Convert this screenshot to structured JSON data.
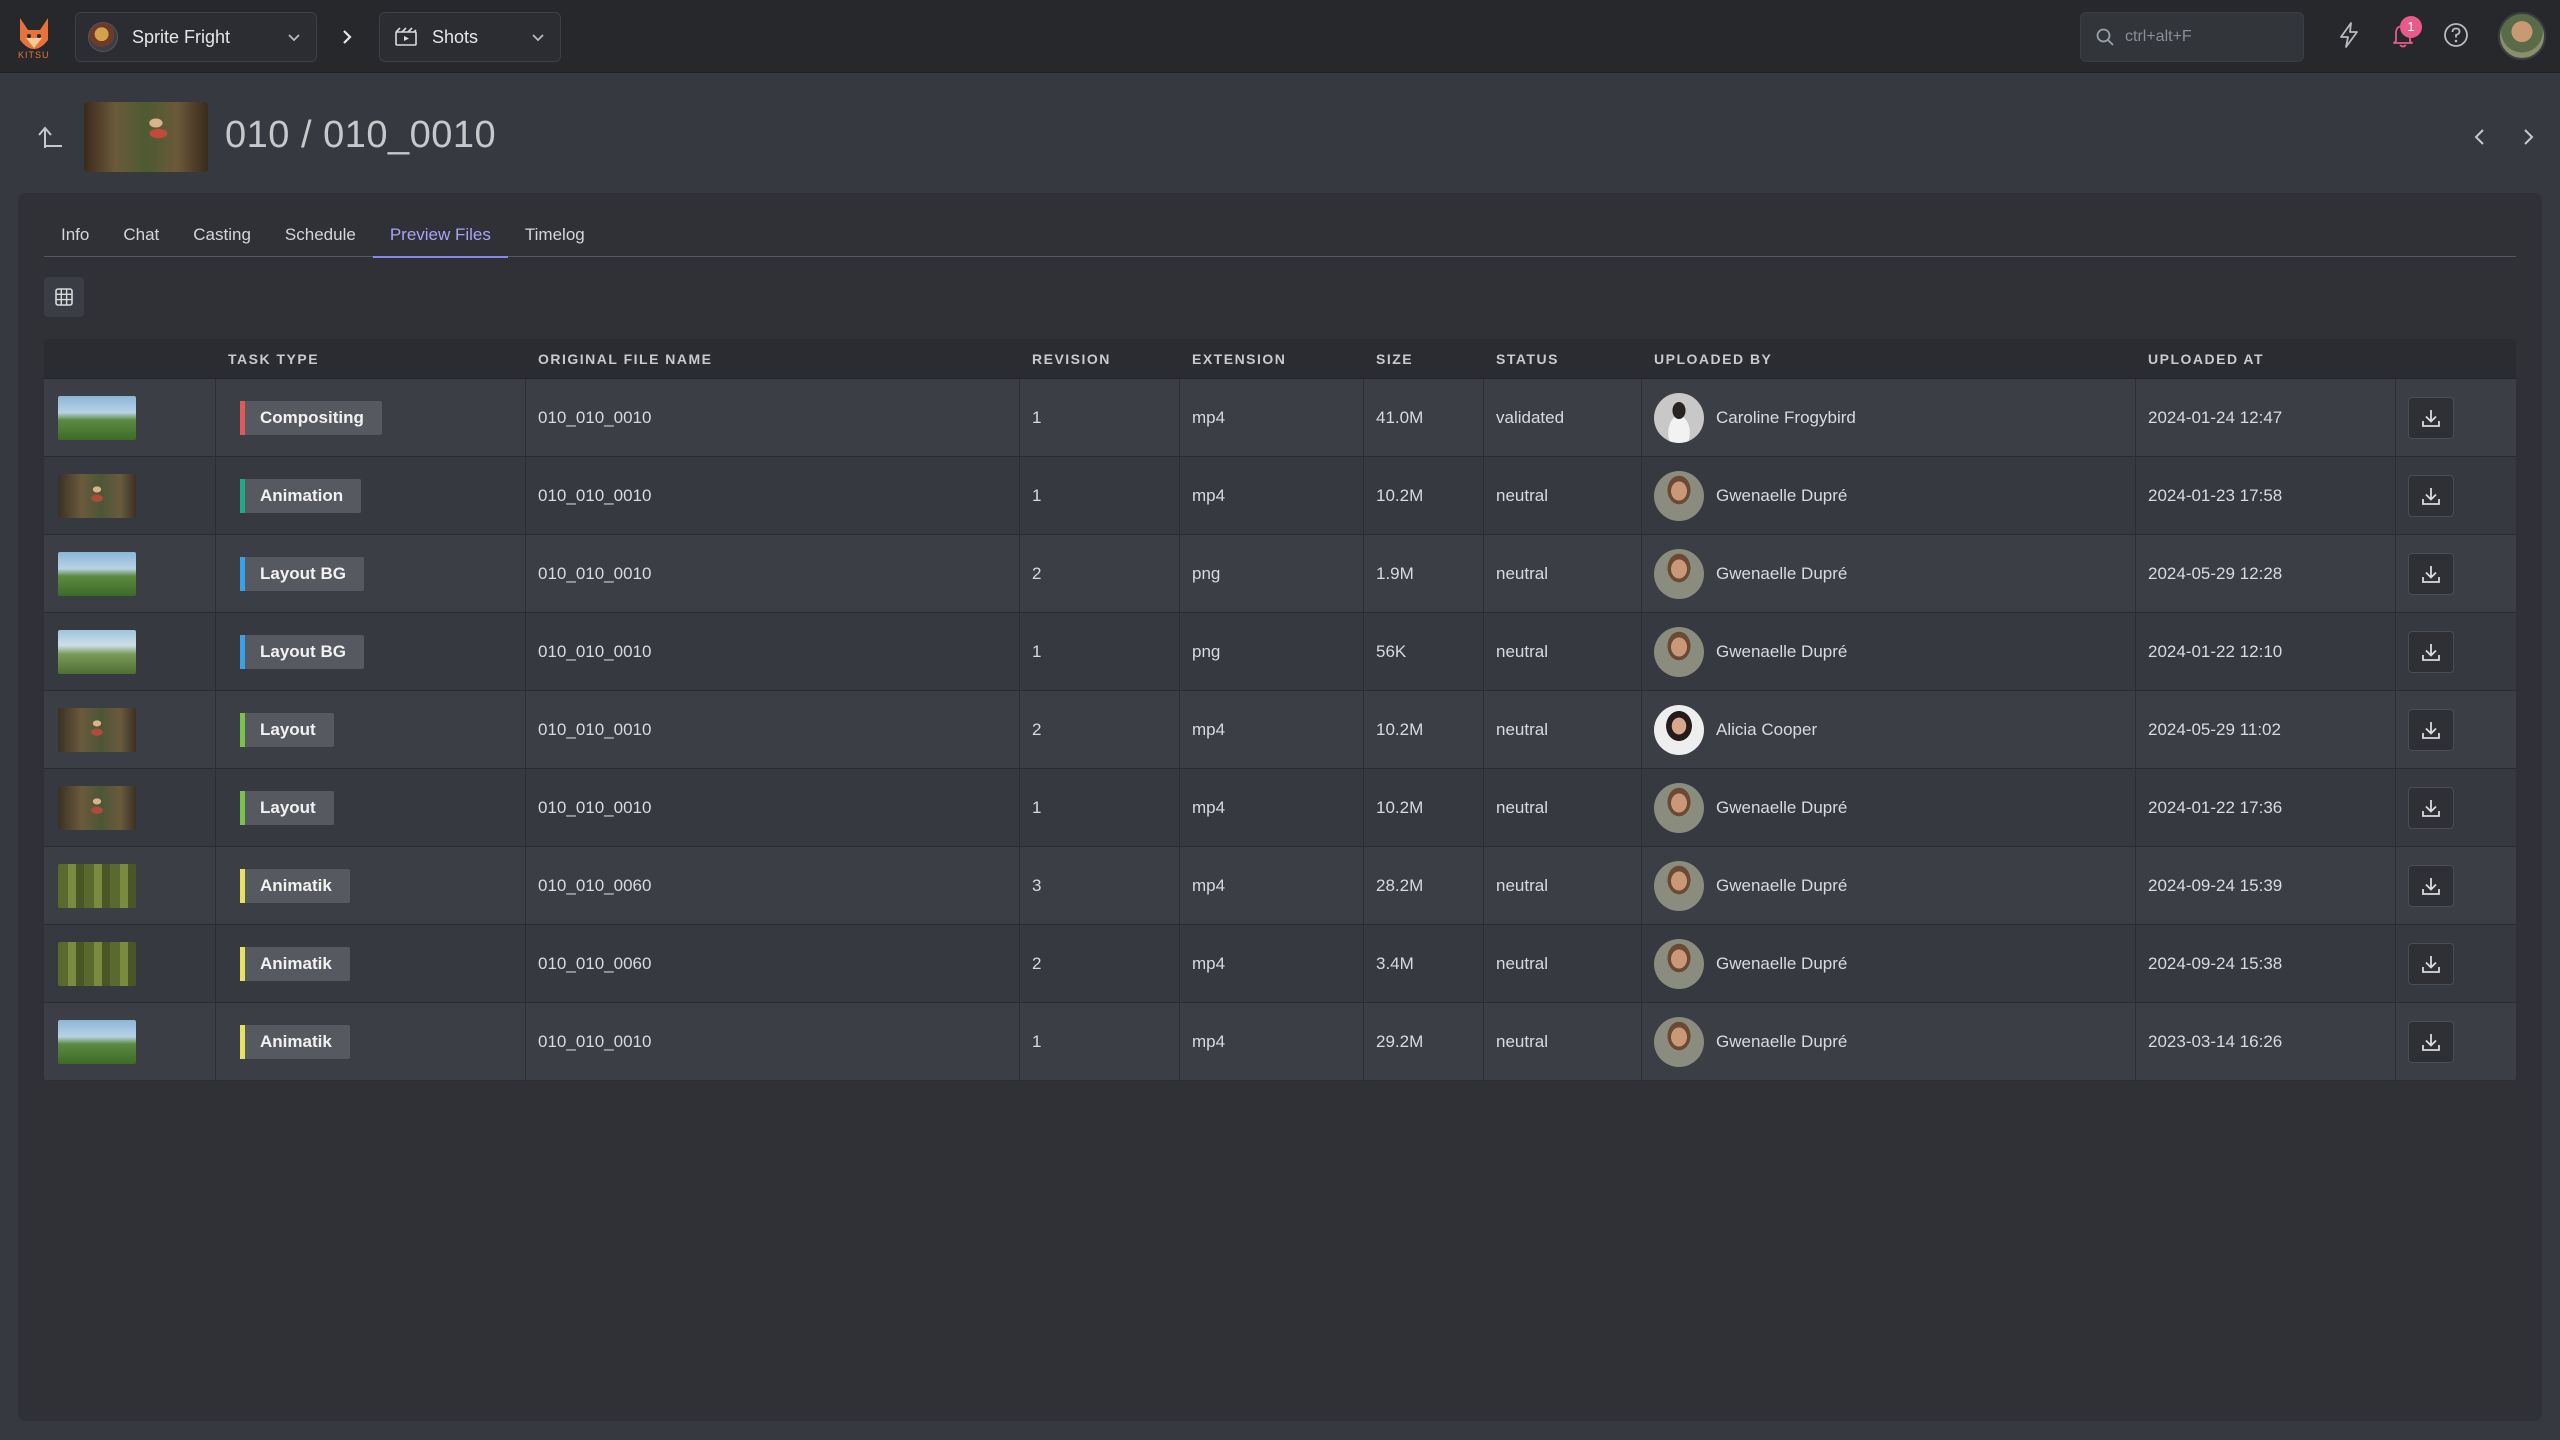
{
  "app": {
    "logo_text": "KITSU"
  },
  "topbar": {
    "production": "Sprite Fright",
    "section": "Shots",
    "search_placeholder": "ctrl+alt+F",
    "notifications_count": "1"
  },
  "header": {
    "title": "010 / 010_0010"
  },
  "tabs": [
    {
      "label": "Info"
    },
    {
      "label": "Chat"
    },
    {
      "label": "Casting"
    },
    {
      "label": "Schedule"
    },
    {
      "label": "Preview Files",
      "active": true
    },
    {
      "label": "Timelog"
    }
  ],
  "table": {
    "columns": [
      "",
      "Task Type",
      "Original File Name",
      "Revision",
      "Extension",
      "Size",
      "Status",
      "Uploaded By",
      "Uploaded At",
      ""
    ],
    "rows": [
      {
        "thumb": "sky",
        "task": "Compositing",
        "task_color": "#e05a5a",
        "file": "010_010_0010",
        "revision": "1",
        "extension": "mp4",
        "size": "41.0M",
        "status": "validated",
        "uploader": "Caroline Frogybird",
        "avatar": "caroline",
        "uploaded_at": "2024-01-24 12:47"
      },
      {
        "thumb": "forest",
        "task": "Animation",
        "task_color": "#24a88a",
        "file": "010_010_0010",
        "revision": "1",
        "extension": "mp4",
        "size": "10.2M",
        "status": "neutral",
        "uploader": "Gwenaelle Dupré",
        "avatar": "gwen",
        "uploaded_at": "2024-01-23 17:58"
      },
      {
        "thumb": "sky",
        "task": "Layout BG",
        "task_color": "#3aa0e8",
        "file": "010_010_0010",
        "revision": "2",
        "extension": "png",
        "size": "1.9M",
        "status": "neutral",
        "uploader": "Gwenaelle Dupré",
        "avatar": "gwen",
        "uploaded_at": "2024-05-29 12:28"
      },
      {
        "thumb": "flat",
        "task": "Layout BG",
        "task_color": "#3aa0e8",
        "file": "010_010_0010",
        "revision": "1",
        "extension": "png",
        "size": "56K",
        "status": "neutral",
        "uploader": "Gwenaelle Dupré",
        "avatar": "gwen",
        "uploaded_at": "2024-01-22 12:10"
      },
      {
        "thumb": "forest",
        "task": "Layout",
        "task_color": "#7ac14a",
        "file": "010_010_0010",
        "revision": "2",
        "extension": "mp4",
        "size": "10.2M",
        "status": "neutral",
        "uploader": "Alicia Cooper",
        "avatar": "alicia",
        "uploaded_at": "2024-05-29 11:02"
      },
      {
        "thumb": "forest",
        "task": "Layout",
        "task_color": "#7ac14a",
        "file": "010_010_0010",
        "revision": "1",
        "extension": "mp4",
        "size": "10.2M",
        "status": "neutral",
        "uploader": "Gwenaelle Dupré",
        "avatar": "gwen",
        "uploaded_at": "2024-01-22 17:36"
      },
      {
        "thumb": "green",
        "task": "Animatik",
        "task_color": "#e8e060",
        "file": "010_010_0060",
        "revision": "3",
        "extension": "mp4",
        "size": "28.2M",
        "status": "neutral",
        "uploader": "Gwenaelle Dupré",
        "avatar": "gwen",
        "uploaded_at": "2024-09-24 15:39"
      },
      {
        "thumb": "green",
        "task": "Animatik",
        "task_color": "#e8e060",
        "file": "010_010_0060",
        "revision": "2",
        "extension": "mp4",
        "size": "3.4M",
        "status": "neutral",
        "uploader": "Gwenaelle Dupré",
        "avatar": "gwen",
        "uploaded_at": "2024-09-24 15:38"
      },
      {
        "thumb": "sky",
        "task": "Animatik",
        "task_color": "#e8e060",
        "file": "010_010_0010",
        "revision": "1",
        "extension": "mp4",
        "size": "29.2M",
        "status": "neutral",
        "uploader": "Gwenaelle Dupré",
        "avatar": "gwen",
        "uploaded_at": "2023-03-14 16:26"
      }
    ]
  }
}
